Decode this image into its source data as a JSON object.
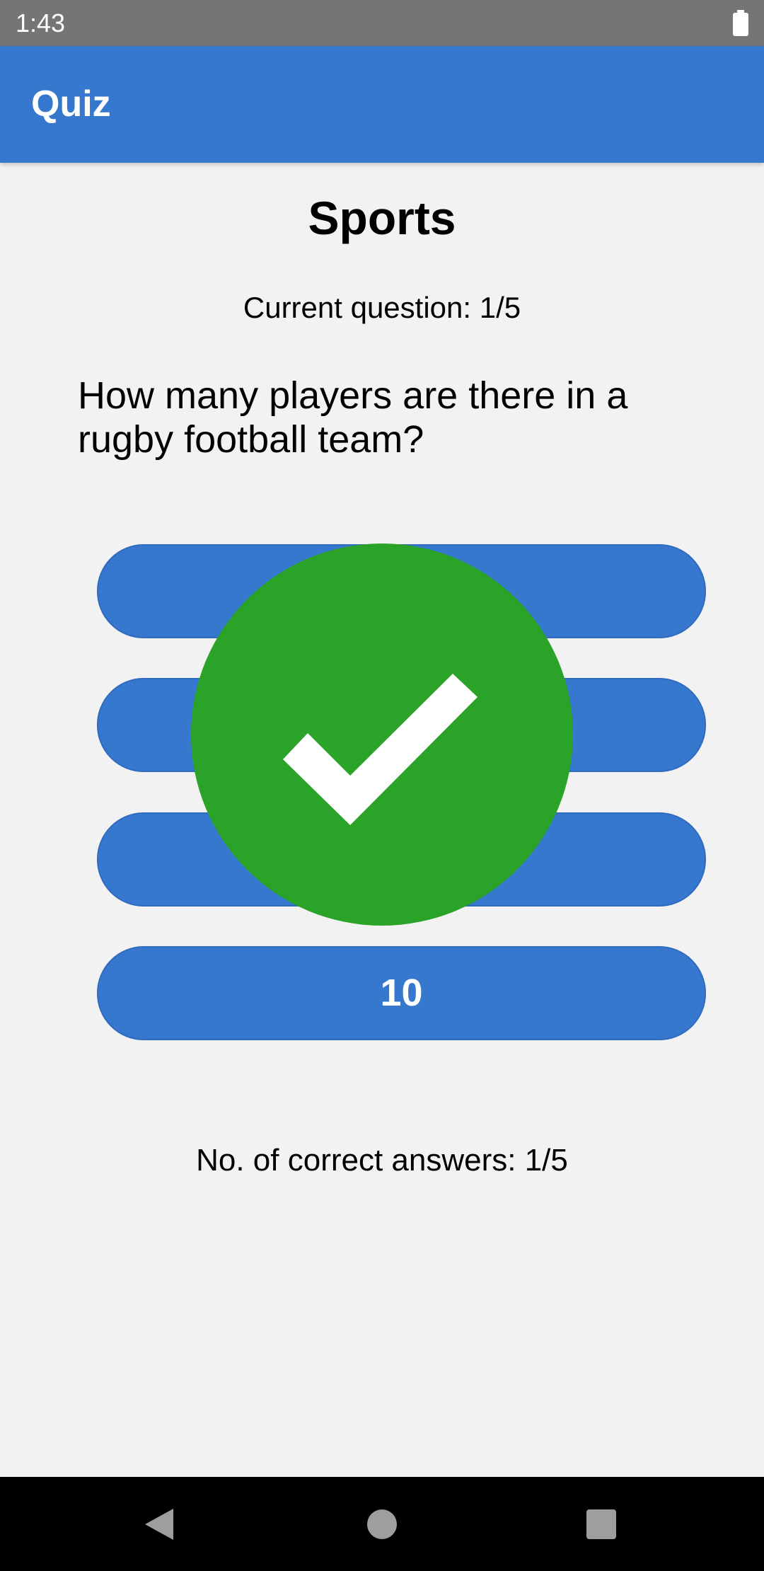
{
  "status_bar": {
    "time": "1:43",
    "battery_icon": "battery-full-icon"
  },
  "app_bar": {
    "title": "Quiz"
  },
  "quiz": {
    "category": "Sports",
    "question_counter": "Current question: 1/5",
    "question": "How many players are there in a rugby football team?",
    "answers": [
      "",
      "",
      "",
      "10"
    ],
    "score": "No. of correct answers: 1/5",
    "result_icon": "check-circle-icon"
  },
  "nav_bar": {
    "back_icon": "back-triangle-icon",
    "home_icon": "home-circle-icon",
    "recents_icon": "recents-square-icon"
  },
  "colors": {
    "primary": "#3578CE",
    "success": "#2BA228",
    "background": "#F2F2F3",
    "status_bar": "#757575",
    "nav_bar": "#000000"
  }
}
